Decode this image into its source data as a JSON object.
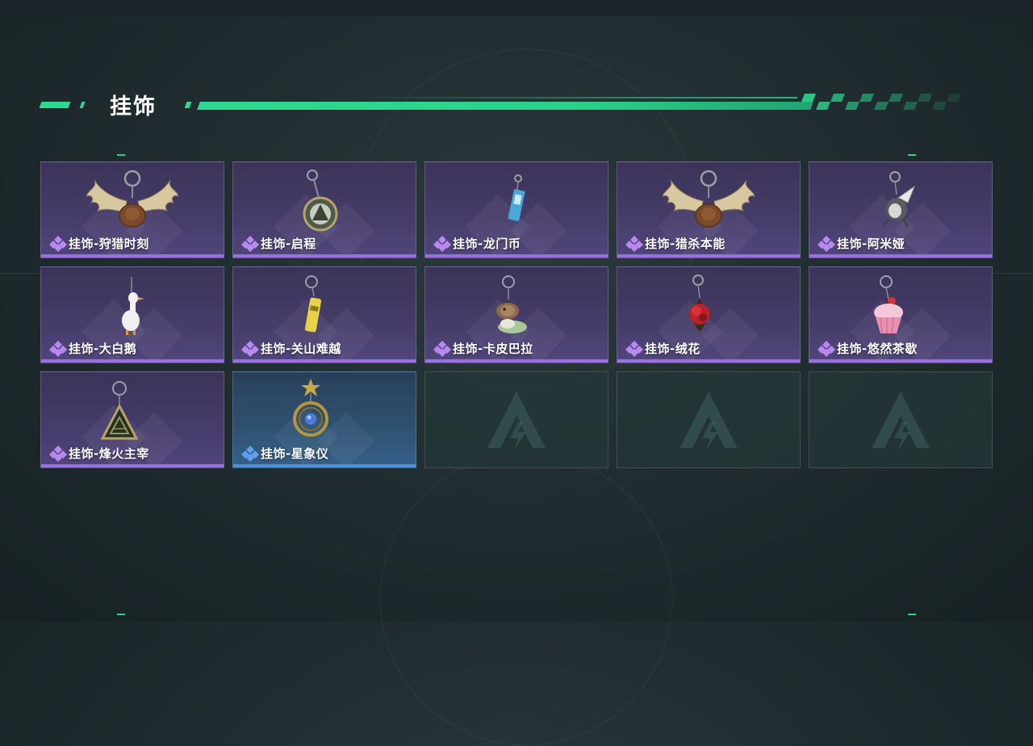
{
  "page": {
    "section_title": "挂饰",
    "accent_color": "#2fd88f"
  },
  "colors": {
    "purple_rarity": "#9a6fe0",
    "blue_rarity": "#4f8fd8"
  },
  "items": [
    {
      "name": "挂饰-狩猎时刻",
      "rarity": "purple",
      "icon": "moose-antler-charm-icon"
    },
    {
      "name": "挂饰-启程",
      "rarity": "purple",
      "icon": "round-emblem-charm-icon"
    },
    {
      "name": "挂饰-龙门币",
      "rarity": "purple",
      "icon": "card-charm-icon"
    },
    {
      "name": "挂饰-猎杀本能",
      "rarity": "purple",
      "icon": "moose-antler-charm-icon"
    },
    {
      "name": "挂饰-阿米娅",
      "rarity": "purple",
      "icon": "bunny-charm-icon"
    },
    {
      "name": "挂饰-大白鹅",
      "rarity": "purple",
      "icon": "goose-charm-icon"
    },
    {
      "name": "挂饰-关山难越",
      "rarity": "purple",
      "icon": "yellow-tube-charm-icon"
    },
    {
      "name": "挂饰-卡皮巴拉",
      "rarity": "purple",
      "icon": "capybara-charm-icon"
    },
    {
      "name": "挂饰-绒花",
      "rarity": "purple",
      "icon": "red-flower-charm-icon"
    },
    {
      "name": "挂饰-悠然茶歇",
      "rarity": "purple",
      "icon": "cupcake-charm-icon"
    },
    {
      "name": "挂饰-烽火主宰",
      "rarity": "purple",
      "icon": "triangle-emblem-charm-icon"
    },
    {
      "name": "挂饰-星象仪",
      "rarity": "blue",
      "icon": "astrolabe-charm-icon"
    }
  ],
  "empty_slots": [
    {
      "icon": "empty-slot-logo-icon"
    },
    {
      "icon": "empty-slot-logo-icon"
    },
    {
      "icon": "empty-slot-logo-icon"
    }
  ]
}
